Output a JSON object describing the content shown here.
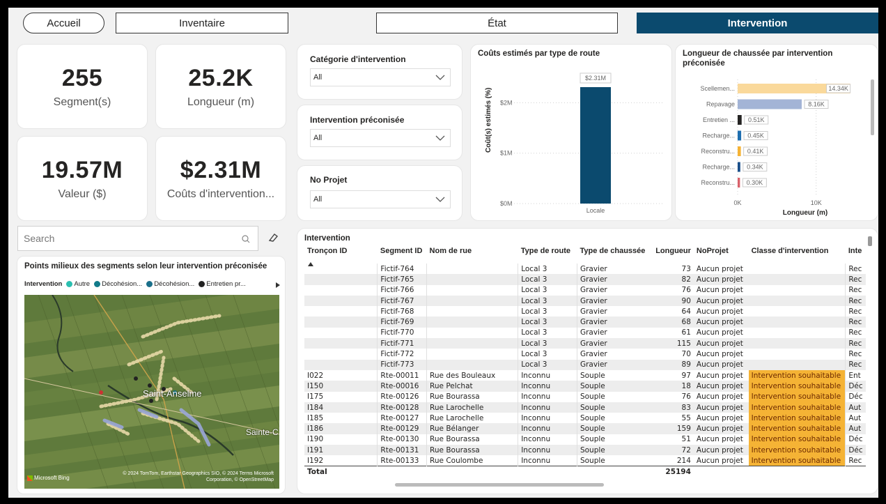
{
  "nav": {
    "home": "Accueil",
    "inventory": "Inventaire",
    "state": "État",
    "intervention": "Intervention"
  },
  "kpis": {
    "segments_value": "255",
    "segments_label": "Segment(s)",
    "length_value": "25.2K",
    "length_label": "Longueur (m)",
    "value_value": "19.57M",
    "value_label": "Valeur ($)",
    "cost_value": "$2.31M",
    "cost_label": "Coûts d'intervention..."
  },
  "slicers": {
    "category_title": "Catégorie d'intervention",
    "category_value": "All",
    "recommended_title": "Intervention préconisée",
    "recommended_value": "All",
    "project_title": "No Projet",
    "project_value": "All"
  },
  "search": {
    "placeholder": "Search"
  },
  "map": {
    "title": "Points milieux des segments selon leur intervention préconisée",
    "legend_title": "Intervention",
    "legend_items": [
      {
        "label": "Autre",
        "color": "#2bbfb0"
      },
      {
        "label": "Décohésion...",
        "color": "#127b8a"
      },
      {
        "label": "Décohésion...",
        "color": "#1a6f8a"
      },
      {
        "label": "Entretien pr...",
        "color": "#222222"
      }
    ],
    "place_1": "Saint-Anselme",
    "place_2": "Sainte-C",
    "bing_label": "Microsoft Bing",
    "attribution": "© 2024 TomTom, Earthstar Geographics SIO, © 2024 Terms Microsoft Corporation, © OpenStreetMap"
  },
  "cost_chart_data": {
    "type": "bar",
    "title": "Coûts estimés par type de route",
    "categories": [
      "Locale"
    ],
    "values": [
      2.31
    ],
    "value_label": "$2.31M",
    "ylabel": "Coût(s) estimés (%)",
    "yticks": [
      "$0M",
      "$1M",
      "$2M"
    ],
    "ylim": [
      0,
      2.6
    ],
    "color": "#0b4a6e"
  },
  "length_chart_data": {
    "type": "bar",
    "orientation": "horizontal",
    "title": "Longueur de chaussée par intervention préconisée",
    "xlabel": "Longueur (m)",
    "xticks": [
      "0K",
      "10K"
    ],
    "xlim": [
      0,
      14.34
    ],
    "categories": [
      "Scellemen...",
      "Repavage",
      "Entretien ...",
      "Recharge...",
      "Reconstru...",
      "Recharge...",
      "Reconstru..."
    ],
    "values": [
      14.34,
      8.16,
      0.51,
      0.45,
      0.41,
      0.34,
      0.3
    ],
    "labels": [
      "14.34K",
      "8.16K",
      "0.51K",
      "0.45K",
      "0.41K",
      "0.34K",
      "0.30K"
    ],
    "colors": [
      "#fad99b",
      "#a3b4d6",
      "#252423",
      "#1f6fb0",
      "#f5b335",
      "#1a4f8a",
      "#d9626b"
    ]
  },
  "table": {
    "title": "Intervention",
    "headers": [
      "Tronçon ID",
      "Segment ID",
      "Nom de rue",
      "Type de route",
      "Type de chaussée",
      "Longueur",
      "NoProjet",
      "Classe d'intervention",
      "Inte"
    ],
    "rows": [
      [
        "",
        "Fictif-764",
        "",
        "Local 3",
        "Gravier",
        "73",
        "Aucun projet",
        "",
        "Rec"
      ],
      [
        "",
        "Fictif-765",
        "",
        "Local 3",
        "Gravier",
        "82",
        "Aucun projet",
        "",
        "Rec"
      ],
      [
        "",
        "Fictif-766",
        "",
        "Local 3",
        "Gravier",
        "76",
        "Aucun projet",
        "",
        "Rec"
      ],
      [
        "",
        "Fictif-767",
        "",
        "Local 3",
        "Gravier",
        "90",
        "Aucun projet",
        "",
        "Rec"
      ],
      [
        "",
        "Fictif-768",
        "",
        "Local 3",
        "Gravier",
        "64",
        "Aucun projet",
        "",
        "Rec"
      ],
      [
        "",
        "Fictif-769",
        "",
        "Local 3",
        "Gravier",
        "68",
        "Aucun projet",
        "",
        "Rec"
      ],
      [
        "",
        "Fictif-770",
        "",
        "Local 3",
        "Gravier",
        "61",
        "Aucun projet",
        "",
        "Rec"
      ],
      [
        "",
        "Fictif-771",
        "",
        "Local 3",
        "Gravier",
        "115",
        "Aucun projet",
        "",
        "Rec"
      ],
      [
        "",
        "Fictif-772",
        "",
        "Local 3",
        "Gravier",
        "70",
        "Aucun projet",
        "",
        "Rec"
      ],
      [
        "",
        "Fictif-773",
        "",
        "Local 3",
        "Gravier",
        "89",
        "Aucun projet",
        "",
        "Rec"
      ],
      [
        "I022",
        "Rte-00011",
        "Rue des Bouleaux",
        "Inconnu",
        "Souple",
        "97",
        "Aucun projet",
        "Intervention souhaitable",
        "Ent"
      ],
      [
        "I150",
        "Rte-00016",
        "Rue Pelchat",
        "Inconnu",
        "Souple",
        "18",
        "Aucun projet",
        "Intervention souhaitable",
        "Déc"
      ],
      [
        "I175",
        "Rte-00126",
        "Rue Bourassa",
        "Inconnu",
        "Souple",
        "76",
        "Aucun projet",
        "Intervention souhaitable",
        "Déc"
      ],
      [
        "I184",
        "Rte-00128",
        "Rue Larochelle",
        "Inconnu",
        "Souple",
        "83",
        "Aucun projet",
        "Intervention souhaitable",
        "Aut"
      ],
      [
        "I185",
        "Rte-00127",
        "Rue Larochelle",
        "Inconnu",
        "Souple",
        "55",
        "Aucun projet",
        "Intervention souhaitable",
        "Aut"
      ],
      [
        "I186",
        "Rte-00129",
        "Rue Bélanger",
        "Inconnu",
        "Souple",
        "159",
        "Aucun projet",
        "Intervention souhaitable",
        "Aut"
      ],
      [
        "I190",
        "Rte-00130",
        "Rue Bourassa",
        "Inconnu",
        "Souple",
        "51",
        "Aucun projet",
        "Intervention souhaitable",
        "Déc"
      ],
      [
        "I191",
        "Rte-00131",
        "Rue Bourassa",
        "Inconnu",
        "Souple",
        "72",
        "Aucun projet",
        "Intervention souhaitable",
        "Déc"
      ],
      [
        "I192",
        "Rte-00133",
        "Rue Coulombe",
        "Inconnu",
        "Souple",
        "214",
        "Aucun projet",
        "Intervention souhaitable",
        "Rec"
      ]
    ],
    "total_label": "Total",
    "total_value": "25194"
  }
}
